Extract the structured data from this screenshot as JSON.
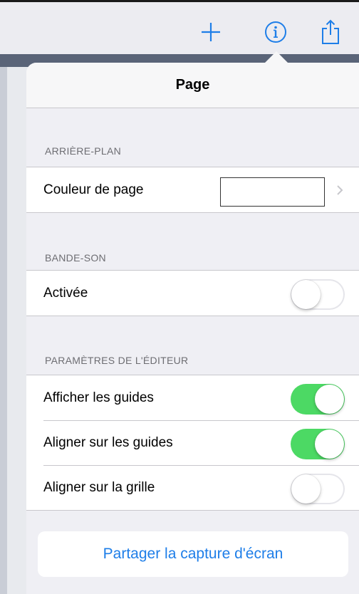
{
  "navbar": {
    "icons": [
      "plus-icon",
      "info-icon",
      "share-icon"
    ]
  },
  "colors": {
    "accent": "#1e7ee8",
    "toggle_on": "#4cd964",
    "group_bg": "#ffffff",
    "popover_bg": "#efeff4"
  },
  "popover": {
    "title": "Page",
    "sections": {
      "background": {
        "header": "ARRIÈRE-PLAN",
        "page_color_label": "Couleur de page",
        "page_color_value": "#ffffff"
      },
      "soundtrack": {
        "header": "BANDE-SON",
        "enabled_label": "Activée",
        "enabled_on": false
      },
      "editor": {
        "header": "PARAMÈTRES DE L'ÉDITEUR",
        "rows": [
          {
            "label": "Afficher les guides",
            "on": true
          },
          {
            "label": "Aligner sur les guides",
            "on": true
          },
          {
            "label": "Aligner sur la grille",
            "on": false
          }
        ]
      }
    },
    "share_button_label": "Partager la capture d'écran"
  }
}
